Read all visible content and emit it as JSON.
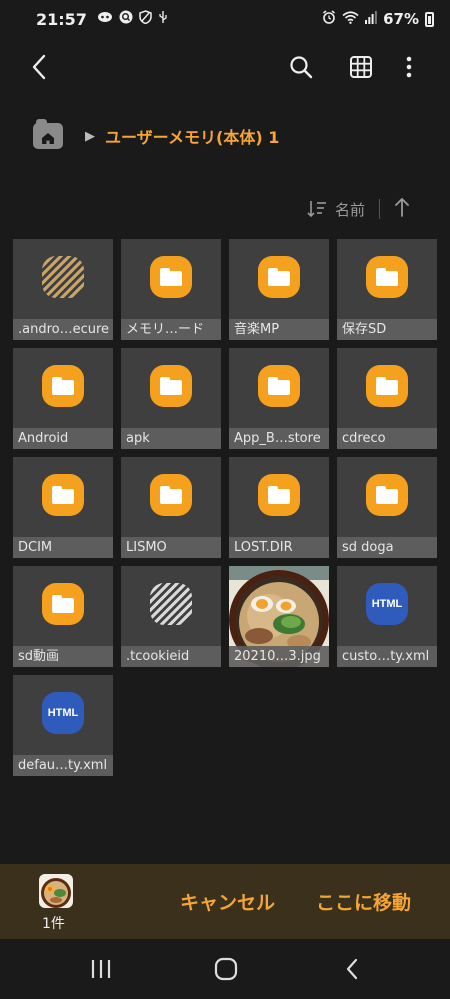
{
  "status_bar": {
    "time": "21:57",
    "battery": "67%",
    "left_icons": [
      "ai-face-icon",
      "search-badge-icon",
      "shield-icon",
      "usb-icon"
    ],
    "right_icons": [
      "alarm-icon",
      "wifi-icon",
      "signal-icon",
      "battery-icon"
    ]
  },
  "toolbar": {
    "icons": [
      "back-icon",
      "search-icon",
      "grid-view-icon",
      "more-icon"
    ]
  },
  "breadcrumb": {
    "path": "ユーザーメモリ(本体) 1"
  },
  "sort": {
    "label": "名前"
  },
  "files": [
    {
      "name": ".andro…ecure",
      "type": "hidden-brown"
    },
    {
      "name": "メモリ…ード",
      "type": "folder"
    },
    {
      "name": "音楽MP",
      "type": "folder"
    },
    {
      "name": "保存SD",
      "type": "folder"
    },
    {
      "name": "Android",
      "type": "folder"
    },
    {
      "name": "apk",
      "type": "folder"
    },
    {
      "name": "App_B…store",
      "type": "folder"
    },
    {
      "name": "cdreco",
      "type": "folder"
    },
    {
      "name": "DCIM",
      "type": "folder"
    },
    {
      "name": "LISMO",
      "type": "folder"
    },
    {
      "name": "LOST.DIR",
      "type": "folder"
    },
    {
      "name": "sd doga",
      "type": "folder"
    },
    {
      "name": "sd動画",
      "type": "folder"
    },
    {
      "name": ".tcookieid",
      "type": "hidden"
    },
    {
      "name": "20210…3.jpg",
      "type": "image"
    },
    {
      "name": "custo…ty.xml",
      "type": "html"
    },
    {
      "name": "defau…ty.xml",
      "type": "html"
    }
  ],
  "html_badge": "HTML",
  "action_bar": {
    "count": "1件",
    "cancel": "キャンセル",
    "move_here": "ここに移動"
  },
  "colors": {
    "accent": "#f6a535",
    "folder": "#f6a11e",
    "html_badge": "#2f5bbd",
    "background": "#1a1a1a",
    "tile": "#3f3f3f",
    "action_bar": "#3a301c"
  }
}
